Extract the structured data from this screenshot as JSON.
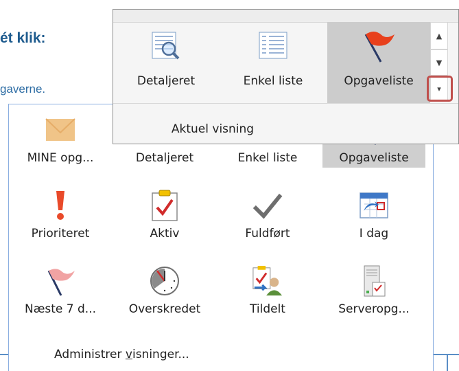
{
  "background": {
    "heading": "ét klik:",
    "subtext": "gaverne."
  },
  "ribbon": {
    "views": [
      {
        "label": "Detaljeret",
        "icon": "detailed-view-icon"
      },
      {
        "label": "Enkel liste",
        "icon": "simple-list-icon"
      },
      {
        "label": "Opgaveliste",
        "icon": "red-flag-icon",
        "selected": true
      }
    ],
    "group_label": "Aktuel visning",
    "highlight_color": "#c0504d"
  },
  "gallery": {
    "rows": [
      [
        {
          "label": "MINE opg...",
          "icon": "envelope-icon"
        },
        {
          "label": "Detaljeret",
          "icon": "detailed-view-icon"
        },
        {
          "label": "Enkel liste",
          "icon": "simple-list-icon"
        },
        {
          "label": "Opgaveliste",
          "icon": "red-flag-icon",
          "selected": true
        }
      ],
      [
        {
          "label": "Prioriteret",
          "icon": "exclamation-icon"
        },
        {
          "label": "Aktiv",
          "icon": "clipboard-check-icon"
        },
        {
          "label": "Fuldført",
          "icon": "checkmark-icon"
        },
        {
          "label": "I dag",
          "icon": "calendar-arrow-icon"
        }
      ],
      [
        {
          "label": "Næste 7 d...",
          "icon": "pink-flag-icon"
        },
        {
          "label": "Overskredet",
          "icon": "clock-icon"
        },
        {
          "label": "Tildelt",
          "icon": "assigned-person-icon"
        },
        {
          "label": "Serveropg...",
          "icon": "server-task-icon"
        }
      ]
    ],
    "manage_prefix": "Administrer ",
    "manage_underlined": "v",
    "manage_suffix": "isninger..."
  }
}
